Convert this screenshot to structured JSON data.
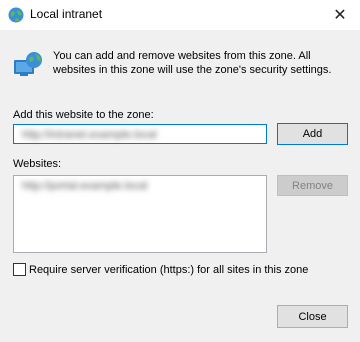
{
  "window": {
    "title": "Local intranet",
    "close_glyph": "✕"
  },
  "info": {
    "text": "You can add and remove websites from this zone. All websites in this zone will use the zone's security settings."
  },
  "add_section": {
    "label": "Add this website to the zone:",
    "input_value": "http://intranet.example.local",
    "add_button": "Add"
  },
  "websites": {
    "label": "Websites:",
    "items": [
      "http://portal.example.local"
    ],
    "remove_button": "Remove"
  },
  "verification": {
    "label": "Require server verification (https:) for all sites in this zone",
    "checked": false
  },
  "footer": {
    "close_button": "Close"
  },
  "colors": {
    "accent": "#0078d7",
    "dialog_bg": "#f0f0f0"
  },
  "icons": {
    "title": "globe-icon",
    "zone": "intranet-zone-icon"
  }
}
